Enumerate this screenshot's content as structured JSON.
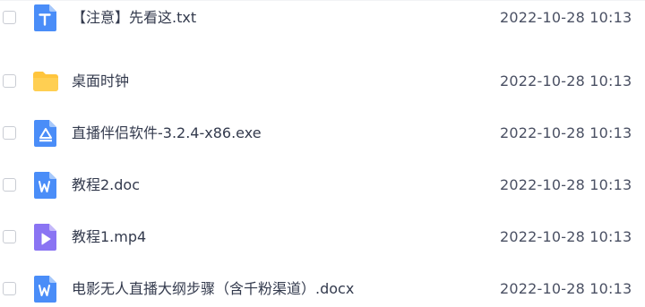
{
  "files": [
    {
      "name": "桌面时钟",
      "date": "2022-10-28 10:13",
      "icon": "folder-icon",
      "color": "#ffc53d"
    },
    {
      "name": "直播伴侣软件-3.2.4-x86.exe",
      "date": "2022-10-28 10:13",
      "icon": "exe-file-icon",
      "color": "#4a8df8"
    },
    {
      "name": "教程2.doc",
      "date": "2022-10-28 10:13",
      "icon": "word-file-icon",
      "color": "#4a8df8"
    },
    {
      "name": "教程1.mp4",
      "date": "2022-10-28 10:13",
      "icon": "video-file-icon",
      "color": "#8a74f3"
    },
    {
      "name": "电影无人直播大纲步骤（含千粉渠道）.docx",
      "date": "2022-10-28 10:13",
      "icon": "word-file-icon",
      "color": "#4a8df8"
    },
    {
      "name": "【注意】先看这.txt",
      "date": "2022-10-28 10:13",
      "icon": "text-file-icon",
      "color": "#4a8df8"
    }
  ]
}
